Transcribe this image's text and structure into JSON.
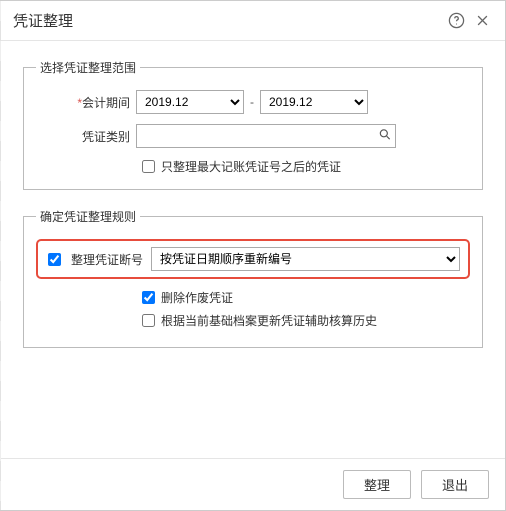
{
  "header": {
    "title": "凭证整理"
  },
  "scope": {
    "legend": "选择凭证整理范围",
    "period_label": "会计期间",
    "period_from": "2019.12",
    "period_to": "2019.12",
    "dash": "-",
    "category_label": "凭证类别",
    "category_value": "",
    "only_after_max_label": "只整理最大记账凭证号之后的凭证"
  },
  "rules": {
    "legend": "确定凭证整理规则",
    "renumber_label": "整理凭证断号",
    "renumber_option": "按凭证日期顺序重新编号",
    "delete_void_label": "删除作废凭证",
    "update_aux_label": "根据当前基础档案更新凭证辅助核算历史"
  },
  "footer": {
    "ok": "整理",
    "cancel": "退出"
  }
}
